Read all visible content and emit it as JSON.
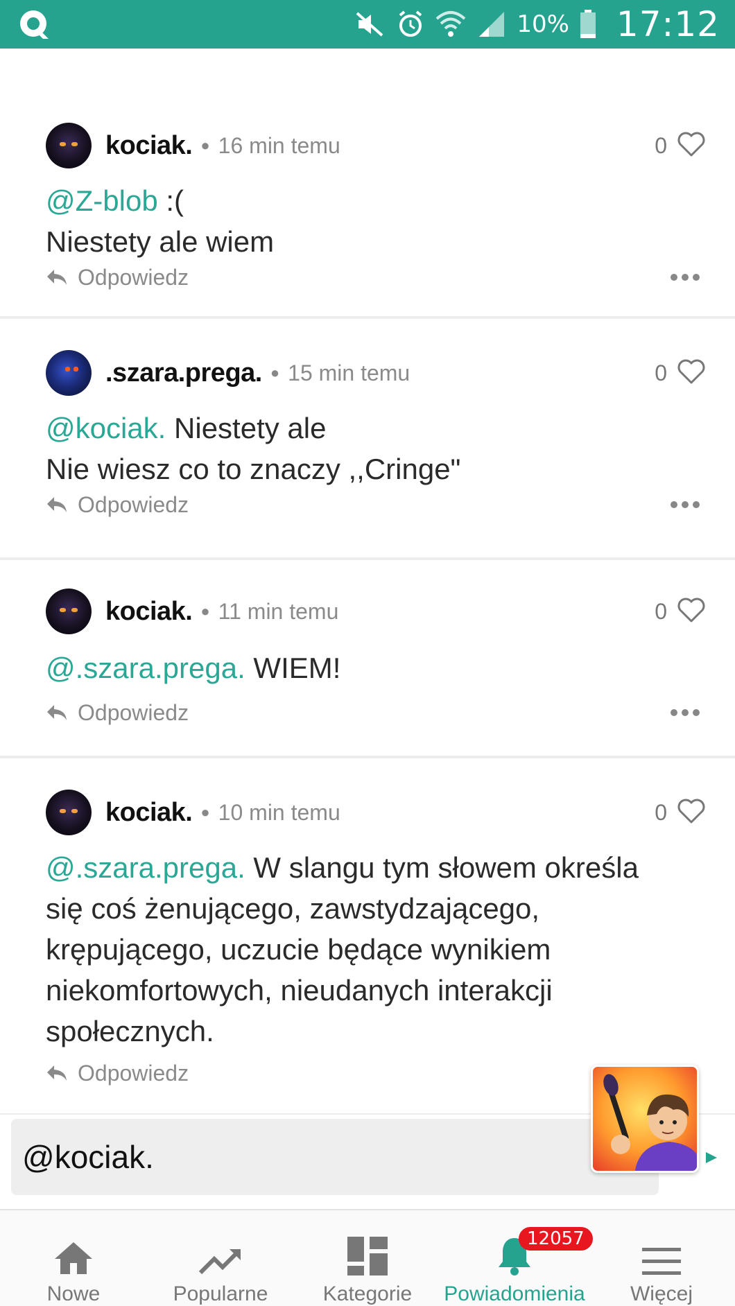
{
  "status_bar": {
    "app_icon": "quotev-logo-icon",
    "icons": [
      "mute-icon",
      "alarm-icon",
      "wifi-icon",
      "signal-icon"
    ],
    "battery": "10%",
    "time": "17:12",
    "color": "#26a38f"
  },
  "comments": [
    {
      "username": "kociak.",
      "time": "16 min temu",
      "likes": "0",
      "mention": "@Z-blob",
      "text_after_mention": " :(",
      "lines": [
        "Niestety ale wiem"
      ],
      "reply": "Odpowiedz"
    },
    {
      "username": ".szara.prega.",
      "time": "15 min temu",
      "likes": "0",
      "mention": "@kociak.",
      "text_after_mention": " Niestety ale",
      "lines": [
        "Nie wiesz co to znaczy ,,Cringe\""
      ],
      "reply": "Odpowiedz"
    },
    {
      "username": "kociak.",
      "time": "11 min temu",
      "likes": "0",
      "mention": "@.szara.prega.",
      "text_after_mention": " WIEM!",
      "lines": [],
      "reply": "Odpowiedz"
    },
    {
      "username": "kociak.",
      "time": "10 min temu",
      "likes": "0",
      "mention": "@.szara.prega.",
      "text_after_mention": " W slangu tym słowem określa",
      "lines": [
        "się coś żenującego, zawstydzającego,",
        "krępującego, uczucie będące wynikiem",
        "niekomfortowych, nieudanych interakcji",
        "społecznych."
      ],
      "reply": "Odpowiedz"
    }
  ],
  "input": {
    "value": "@kociak."
  },
  "bottom_nav": [
    {
      "label": "Nowe",
      "icon": "home-icon"
    },
    {
      "label": "Popularne",
      "icon": "trending-icon"
    },
    {
      "label": "Kategorie",
      "icon": "categories-icon"
    },
    {
      "label": "Powiadomienia",
      "icon": "bell-icon",
      "badge": "12057",
      "active": true
    },
    {
      "label": "Więcej",
      "icon": "menu-icon"
    }
  ],
  "colors": {
    "accent": "#26a38f",
    "mention": "#2aa795",
    "badge": "#e8171f"
  }
}
